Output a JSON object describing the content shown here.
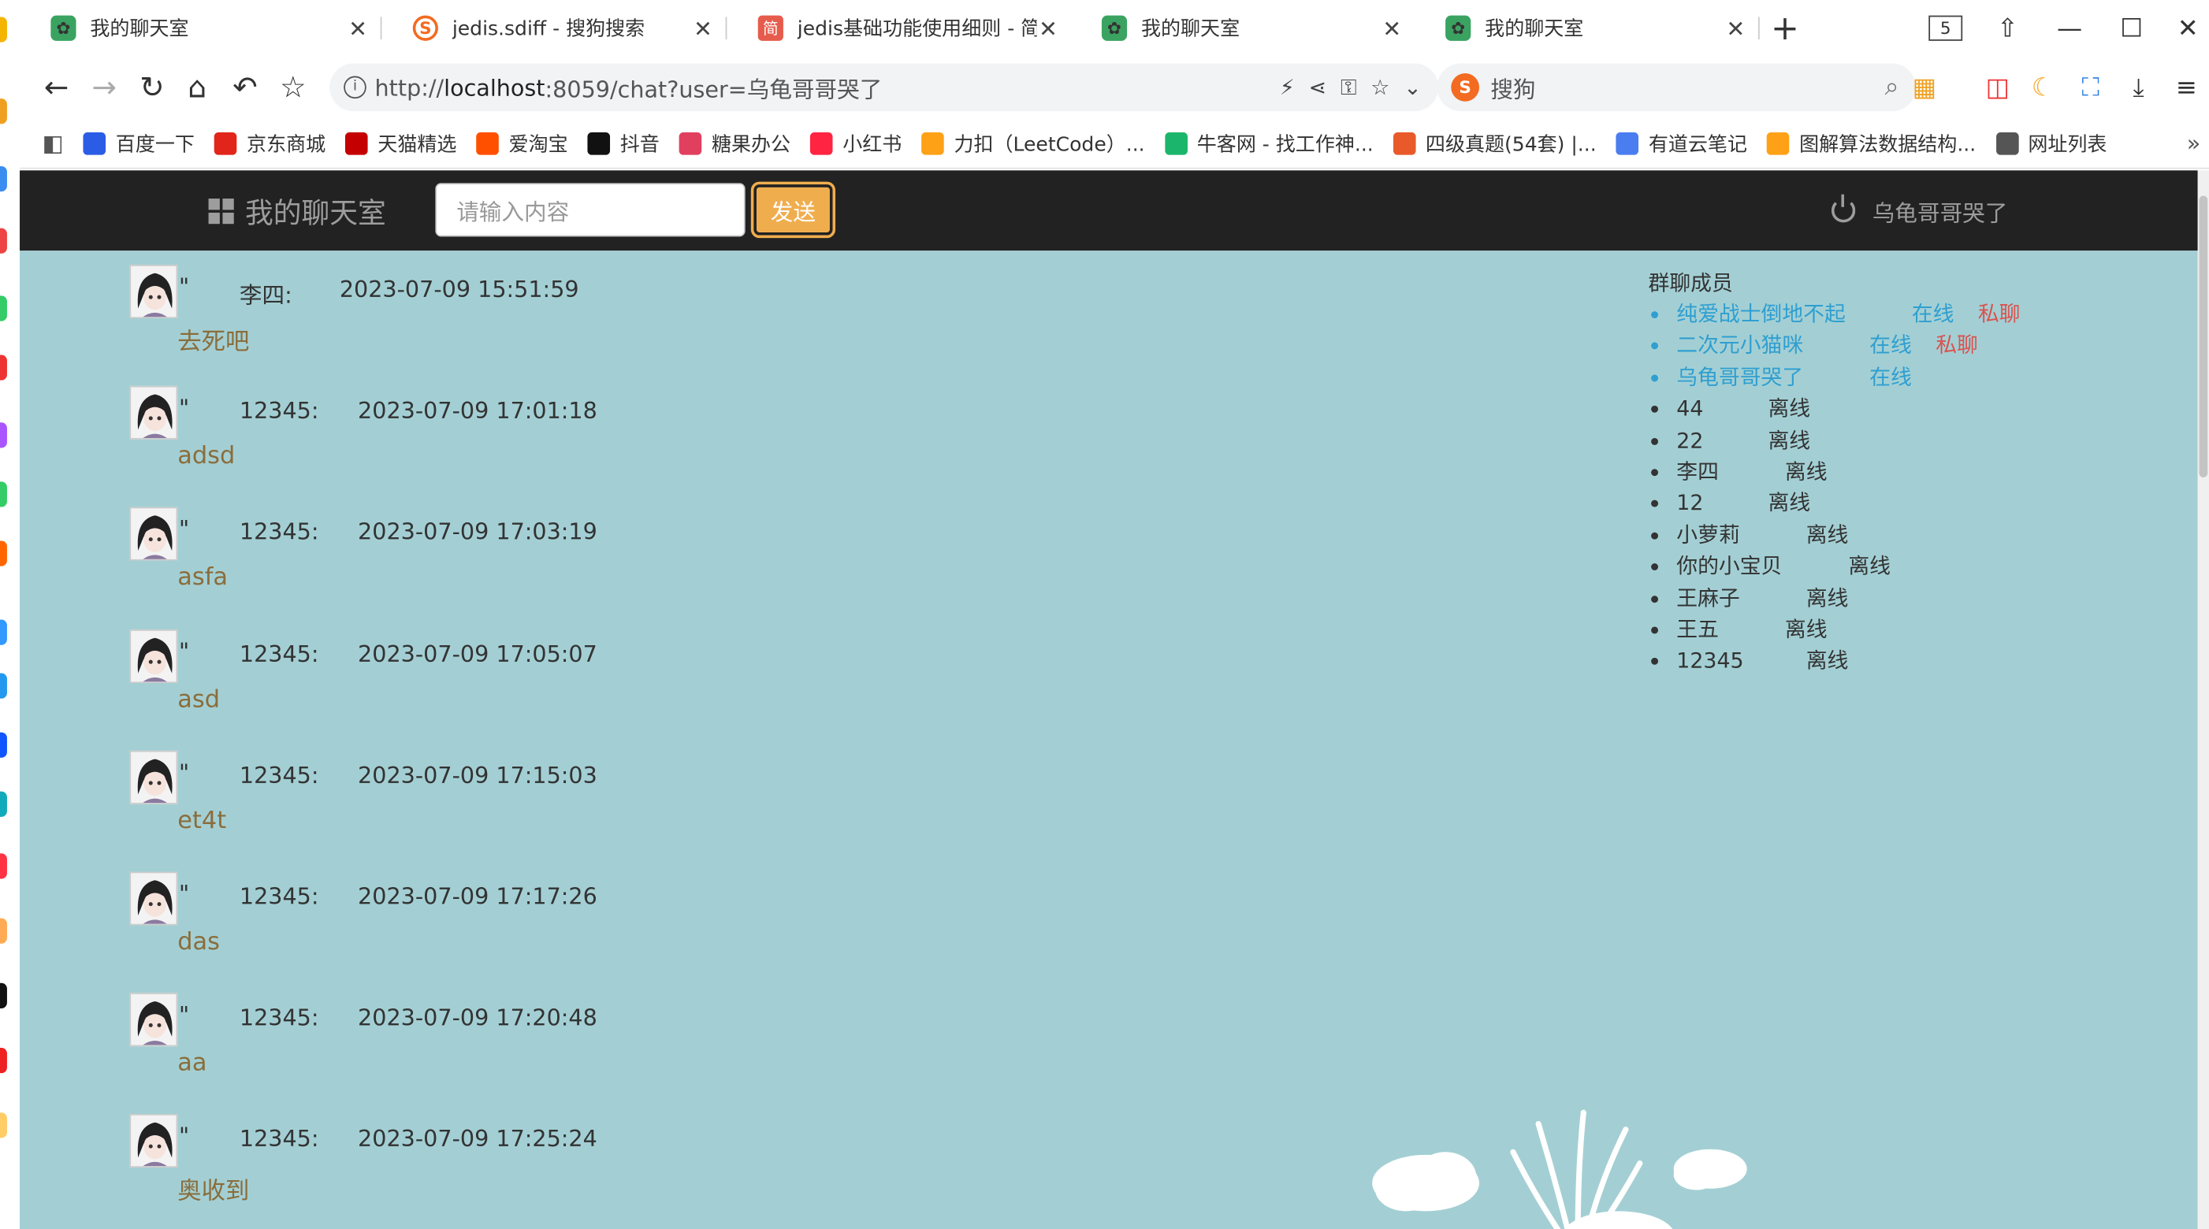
{
  "browser": {
    "tabs": [
      {
        "title": "我的聊天室"
      },
      {
        "title": "jedis.sdiff - 搜狗搜索"
      },
      {
        "title": "jedis基础功能使用细则 - 简书"
      },
      {
        "title": "我的聊天室"
      },
      {
        "title": "我的聊天室"
      }
    ],
    "tab_count_badge": "5",
    "url_prefix": "http://",
    "url_host": "localhost",
    "url_rest": ":8059/chat?user=乌龟哥哥哭了",
    "search_engine_label": "搜狗",
    "bookmarks": [
      {
        "label": "百度一下",
        "color": "#2b5ce6"
      },
      {
        "label": "京东商城",
        "color": "#e1251b"
      },
      {
        "label": "天猫精选",
        "color": "#c40000"
      },
      {
        "label": "爱淘宝",
        "color": "#ff5000"
      },
      {
        "label": "抖音",
        "color": "#111111"
      },
      {
        "label": "糖果办公",
        "color": "#e0405e"
      },
      {
        "label": "小红书",
        "color": "#ff2442"
      },
      {
        "label": "力扣（LeetCode）...",
        "color": "#ffa116"
      },
      {
        "label": "牛客网 - 找工作神...",
        "color": "#1bb66b"
      },
      {
        "label": "四级真题(54套) |...",
        "color": "#e85a2a"
      },
      {
        "label": "有道云笔记",
        "color": "#4a7df0"
      },
      {
        "label": "图解算法数据结构...",
        "color": "#ffa116"
      },
      {
        "label": "网址列表",
        "color": "#555555"
      }
    ]
  },
  "app": {
    "brand": "我的聊天室",
    "input_placeholder": "请输入内容",
    "send_label": "发送",
    "current_user": "乌龟哥哥哭了",
    "quote_char": "\""
  },
  "messages": [
    {
      "sender": "李四:",
      "time": "2023-07-09 15:51:59",
      "text": "去死吧"
    },
    {
      "sender": "12345:",
      "time": "2023-07-09 17:01:18",
      "text": "adsd"
    },
    {
      "sender": "12345:",
      "time": "2023-07-09 17:03:19",
      "text": "asfa"
    },
    {
      "sender": "12345:",
      "time": "2023-07-09 17:05:07",
      "text": "asd"
    },
    {
      "sender": "12345:",
      "time": "2023-07-09 17:15:03",
      "text": "et4t"
    },
    {
      "sender": "12345:",
      "time": "2023-07-09 17:17:26",
      "text": "das"
    },
    {
      "sender": "12345:",
      "time": "2023-07-09 17:20:48",
      "text": "aa"
    },
    {
      "sender": "12345:",
      "time": "2023-07-09 17:25:24",
      "text": "奥收到"
    }
  ],
  "members": {
    "title": "群聊成员",
    "list": [
      {
        "name": "纯爱战士倒地不起",
        "status": "在线",
        "private_chat": "私聊",
        "online": true
      },
      {
        "name": "二次元小猫咪",
        "status": "在线",
        "private_chat": "私聊",
        "online": true
      },
      {
        "name": "乌龟哥哥哭了",
        "status": "在线",
        "private_chat": "",
        "online": true
      },
      {
        "name": "44",
        "status": "离线",
        "private_chat": "",
        "online": false
      },
      {
        "name": "22",
        "status": "离线",
        "private_chat": "",
        "online": false
      },
      {
        "name": "李四",
        "status": "离线",
        "private_chat": "",
        "online": false
      },
      {
        "name": "12",
        "status": "离线",
        "private_chat": "",
        "online": false
      },
      {
        "name": "小萝莉",
        "status": "离线",
        "private_chat": "",
        "online": false
      },
      {
        "name": "你的小宝贝",
        "status": "离线",
        "private_chat": "",
        "online": false
      },
      {
        "name": "王麻子",
        "status": "离线",
        "private_chat": "",
        "online": false
      },
      {
        "name": "王五",
        "status": "离线",
        "private_chat": "",
        "online": false
      },
      {
        "name": "12345",
        "status": "离线",
        "private_chat": "",
        "online": false
      }
    ]
  },
  "colors": {
    "page_bg": "#a3cfd4",
    "navbar_bg": "#222222",
    "send_button": "#f0ad4e",
    "online": "#2f9fd0",
    "private_chat": "#d9534f",
    "message_text": "#8a6d3b"
  }
}
